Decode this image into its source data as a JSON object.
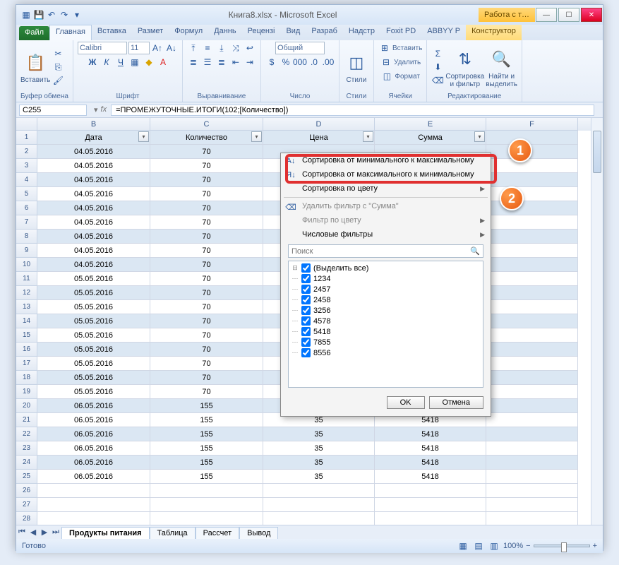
{
  "window": {
    "title": "Книга8.xlsx - Microsoft Excel",
    "context_tab": "Работа с т…"
  },
  "qat": {
    "save": "💾",
    "undo": "↶",
    "redo": "↷"
  },
  "winbtns": {
    "min": "—",
    "max": "☐",
    "close": "✕"
  },
  "tabs": {
    "file": "Файл",
    "home": "Главная",
    "insert": "Вставка",
    "layout": "Размет",
    "formulas": "Формул",
    "data": "Даннь",
    "review": "Рецензі",
    "view": "Вид",
    "dev": "Разраб",
    "addins": "Надстр",
    "foxit": "Foxit PD",
    "abbyy": "ABBYY P",
    "design": "Конструктор"
  },
  "ribbon": {
    "clipboard": {
      "paste": "Вставить",
      "label": "Буфер обмена"
    },
    "font": {
      "name": "Calibri",
      "size": "11",
      "label": "Шрифт"
    },
    "align": {
      "label": "Выравнивание"
    },
    "number": {
      "label": "Число",
      "format": "Общий"
    },
    "styles": {
      "label": "Стили",
      "btn": "Стили"
    },
    "cells": {
      "insert": "Вставить",
      "delete": "Удалить",
      "format": "Формат",
      "label": "Ячейки"
    },
    "editing": {
      "sort": "Сортировка\nи фильтр",
      "find": "Найти и\nвыделить",
      "label": "Редактирование"
    }
  },
  "namebox": "C255",
  "formula": "=ПРОМЕЖУТОЧНЫЕ.ИТОГИ(102;[Количество])",
  "cols": [
    "B",
    "C",
    "D",
    "E",
    "F"
  ],
  "headers": {
    "b": "Дата",
    "c": "Количество",
    "d": "Цена",
    "e": "Сумма"
  },
  "rows_top": [
    {
      "n": 2,
      "b": "04.05.2016",
      "c": "70"
    },
    {
      "n": 3,
      "b": "04.05.2016",
      "c": "70"
    },
    {
      "n": 4,
      "b": "04.05.2016",
      "c": "70"
    },
    {
      "n": 5,
      "b": "04.05.2016",
      "c": "70"
    },
    {
      "n": 6,
      "b": "04.05.2016",
      "c": "70"
    },
    {
      "n": 7,
      "b": "04.05.2016",
      "c": "70"
    },
    {
      "n": 8,
      "b": "04.05.2016",
      "c": "70"
    },
    {
      "n": 9,
      "b": "04.05.2016",
      "c": "70"
    },
    {
      "n": 10,
      "b": "04.05.2016",
      "c": "70"
    },
    {
      "n": 11,
      "b": "05.05.2016",
      "c": "70"
    },
    {
      "n": 12,
      "b": "05.05.2016",
      "c": "70"
    },
    {
      "n": 13,
      "b": "05.05.2016",
      "c": "70"
    },
    {
      "n": 14,
      "b": "05.05.2016",
      "c": "70"
    },
    {
      "n": 15,
      "b": "05.05.2016",
      "c": "70"
    },
    {
      "n": 16,
      "b": "05.05.2016",
      "c": "70"
    },
    {
      "n": 17,
      "b": "05.05.2016",
      "c": "70"
    },
    {
      "n": 18,
      "b": "05.05.2016",
      "c": "70"
    },
    {
      "n": 19,
      "b": "05.05.2016",
      "c": "70"
    },
    {
      "n": 20,
      "b": "06.05.2016",
      "c": "155"
    }
  ],
  "rows_bot": [
    {
      "n": 21,
      "b": "06.05.2016",
      "c": "155",
      "d": "35",
      "e": "5418"
    },
    {
      "n": 22,
      "b": "06.05.2016",
      "c": "155",
      "d": "35",
      "e": "5418"
    },
    {
      "n": 23,
      "b": "06.05.2016",
      "c": "155",
      "d": "35",
      "e": "5418"
    },
    {
      "n": 24,
      "b": "06.05.2016",
      "c": "155",
      "d": "35",
      "e": "5418"
    },
    {
      "n": 25,
      "b": "06.05.2016",
      "c": "155",
      "d": "35",
      "e": "5418"
    }
  ],
  "sheets": {
    "s1": "Продукты питания",
    "s2": "Таблица",
    "s3": "Рассчет",
    "s4": "Вывод"
  },
  "status": {
    "ready": "Готово",
    "zoom": "100%"
  },
  "filter": {
    "sort_asc": "Сортировка от минимального к максимальному",
    "sort_desc": "Сортировка от максимального к минимальному",
    "sort_color": "Сортировка по цвету",
    "clear": "Удалить фильтр с \"Сумма\"",
    "filter_color": "Фильтр по цвету",
    "number_filters": "Числовые фильтры",
    "search_ph": "Поиск",
    "select_all": "(Выделить все)",
    "items": [
      "1234",
      "2457",
      "2458",
      "3256",
      "4578",
      "5418",
      "7855",
      "8556"
    ],
    "ok": "OK",
    "cancel": "Отмена"
  },
  "annot": {
    "one": "1",
    "two": "2"
  }
}
